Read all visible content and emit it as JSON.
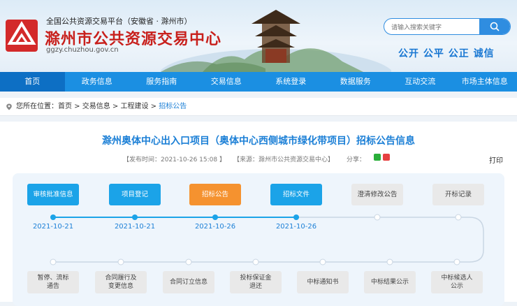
{
  "header": {
    "platform_line": "全国公共资源交易平台（安徽省 · 滁州市）",
    "site_name": "滁州市公共资源交易中心",
    "domain": "ggzy.chuzhou.gov.cn",
    "search_placeholder": "请输入搜索关键字",
    "search_icon": "search-icon",
    "slogan": "公开 公平 公正 诚信",
    "brand_color": "#c8201c",
    "accent_color": "#1b8fe2"
  },
  "nav": {
    "items": [
      "首页",
      "政务信息",
      "服务指南",
      "交易信息",
      "系统登录",
      "数据服务",
      "互动交流",
      "市场主体信息"
    ],
    "active_index": 0
  },
  "breadcrumb": {
    "prefix": "您所在位置：",
    "items": [
      "首页",
      "交易信息",
      "工程建设",
      "招标公告"
    ],
    "separator": " > "
  },
  "article": {
    "title": "滁州奥体中心出入口项目（奥体中心西侧城市绿化带项目）招标公告信息",
    "publish_time": "【发布时间：2021-10-26 15:08 】",
    "source": "【来源：滁州市公共资源交易中心】",
    "share_label": "分享：",
    "share_icons": [
      "wechat-icon",
      "weibo-icon"
    ],
    "print_label": "打印"
  },
  "process": {
    "top_steps": [
      {
        "label": "审核批准信息",
        "state": "done",
        "date": "2021-10-21"
      },
      {
        "label": "项目登记",
        "state": "done",
        "date": "2021-10-21"
      },
      {
        "label": "招标公告",
        "state": "current",
        "date": "2021-10-26"
      },
      {
        "label": "招标文件",
        "state": "done",
        "date": "2021-10-26"
      },
      {
        "label": "澄清修改公告",
        "state": "todo",
        "date": ""
      },
      {
        "label": "开标记录",
        "state": "todo",
        "date": ""
      }
    ],
    "bottom_steps": [
      {
        "label": "暂停、流标\n通告"
      },
      {
        "label": "合同履行及\n变更信息"
      },
      {
        "label": "合同订立信息"
      },
      {
        "label": "投标保证金\n退还"
      },
      {
        "label": "中标通知书"
      },
      {
        "label": "中标结果公示"
      },
      {
        "label": "中标候选人\n公示"
      }
    ],
    "colors": {
      "done": "#1ba3e8",
      "current": "#f5922f",
      "todo": "#e9e9e9"
    }
  }
}
